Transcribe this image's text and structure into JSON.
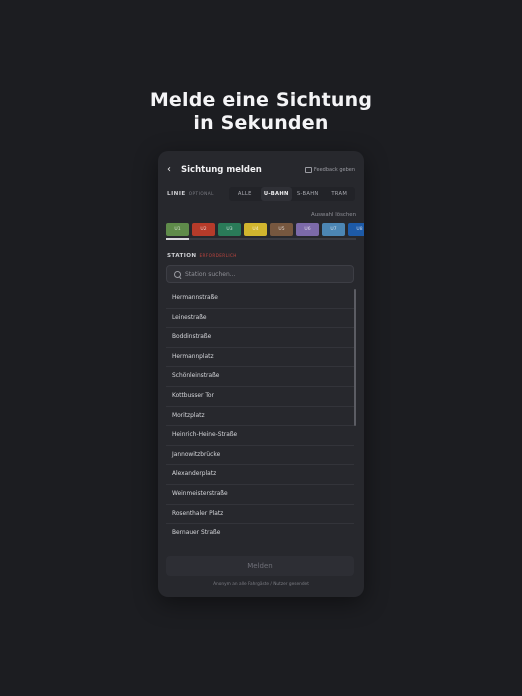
{
  "headline": {
    "line1": "Melde eine Sichtung",
    "line2": "in Sekunden"
  },
  "header": {
    "back_icon": "chevron-left-icon",
    "title": "Sichtung melden",
    "feedback_icon": "message-icon",
    "feedback_label": "Feedback geben"
  },
  "line_filter": {
    "label": "LINIE",
    "optional": "OPTIONAL",
    "tabs": [
      {
        "label": "ALLE",
        "active": false
      },
      {
        "label": "U-BAHN",
        "active": true
      },
      {
        "label": "S-BAHN",
        "active": false
      },
      {
        "label": "TRAM",
        "active": false
      }
    ],
    "clear_label": "Auswahl löschen",
    "lines": [
      {
        "label": "U1",
        "color": "#5f8b4a"
      },
      {
        "label": "U2",
        "color": "#b63b2a"
      },
      {
        "label": "U3",
        "color": "#2a7a58"
      },
      {
        "label": "U4",
        "color": "#d1b52e"
      },
      {
        "label": "U5",
        "color": "#76573f"
      },
      {
        "label": "U6",
        "color": "#7c6aa9"
      },
      {
        "label": "U7",
        "color": "#4c86b4"
      },
      {
        "label": "U8",
        "color": "#1d5aa7"
      }
    ]
  },
  "station": {
    "label": "STATION",
    "required": "ERFORDERLICH",
    "search_placeholder": "Station suchen...",
    "items": [
      "Hermannstraße",
      "Leinestraße",
      "Boddinstraße",
      "Hermannplatz",
      "Schönleinstraße",
      "Kottbusser Tor",
      "Moritzplatz",
      "Heinrich-Heine-Straße",
      "Jannowitzbrücke",
      "Alexanderplatz",
      "Weinmeisterstraße",
      "Rosenthaler Platz",
      "Bernauer Straße"
    ]
  },
  "submit_label": "Melden",
  "footnote": "Anonym an alle Fahrgäste / Nutzer gesendet",
  "colors": {
    "background": "#1c1d21",
    "card": "#27282d",
    "required": "#c2453f"
  }
}
